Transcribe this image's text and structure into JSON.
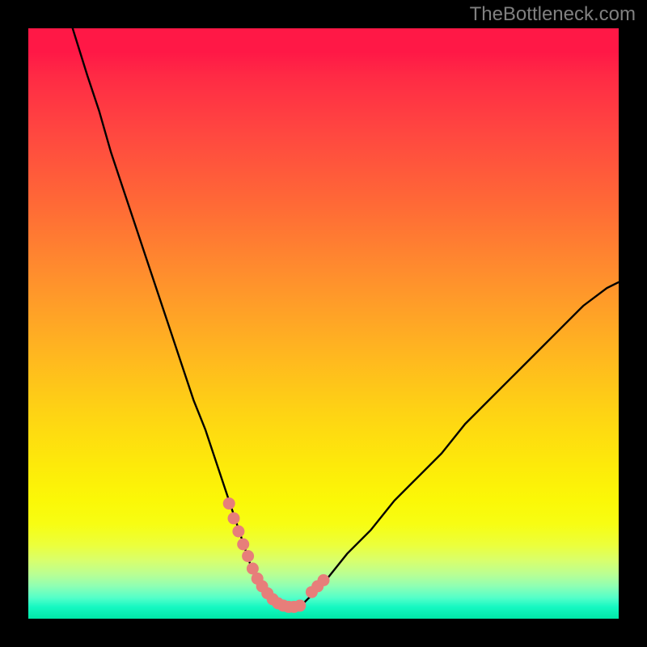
{
  "watermark": "TheBottleneck.com",
  "colors": {
    "frame": "#000000",
    "curve_stroke": "#000000",
    "marker_fill": "#e77e7a",
    "gradient_top": "#ff1846",
    "gradient_bottom": "#00e9a8"
  },
  "chart_data": {
    "type": "line",
    "title": "",
    "xlabel": "",
    "ylabel": "",
    "xlim": [
      0,
      100
    ],
    "ylim": [
      0,
      100
    ],
    "grid": false,
    "series": [
      {
        "name": "bottleneck-curve",
        "x": [
          7.5,
          10,
          12,
          14,
          16,
          18,
          20,
          22,
          24,
          26,
          28,
          30,
          32,
          34,
          35,
          36,
          37,
          38,
          39,
          40,
          41,
          42,
          43,
          44,
          46,
          48,
          50,
          54,
          58,
          62,
          66,
          70,
          74,
          78,
          82,
          86,
          90,
          94,
          98,
          100
        ],
        "y": [
          100,
          92,
          86,
          79,
          73,
          67,
          61,
          55,
          49,
          43,
          37,
          32,
          26,
          20,
          17,
          14,
          11,
          8,
          6,
          4,
          3,
          2,
          2,
          2,
          2,
          4,
          6,
          11,
          15,
          20,
          24,
          28,
          33,
          37,
          41,
          45,
          49,
          53,
          56,
          57
        ]
      }
    ],
    "markers": {
      "name": "highlighted-points",
      "x": [
        34.0,
        34.8,
        35.6,
        36.4,
        37.2,
        38.0,
        38.8,
        39.6,
        40.5,
        41.4,
        42.3,
        43.2,
        44.1,
        45.0,
        46.0,
        48.0,
        49.0,
        50.0
      ],
      "y": [
        19.5,
        17.0,
        14.8,
        12.6,
        10.6,
        8.5,
        6.8,
        5.5,
        4.3,
        3.3,
        2.6,
        2.2,
        2.0,
        2.0,
        2.2,
        4.5,
        5.5,
        6.5
      ]
    }
  }
}
